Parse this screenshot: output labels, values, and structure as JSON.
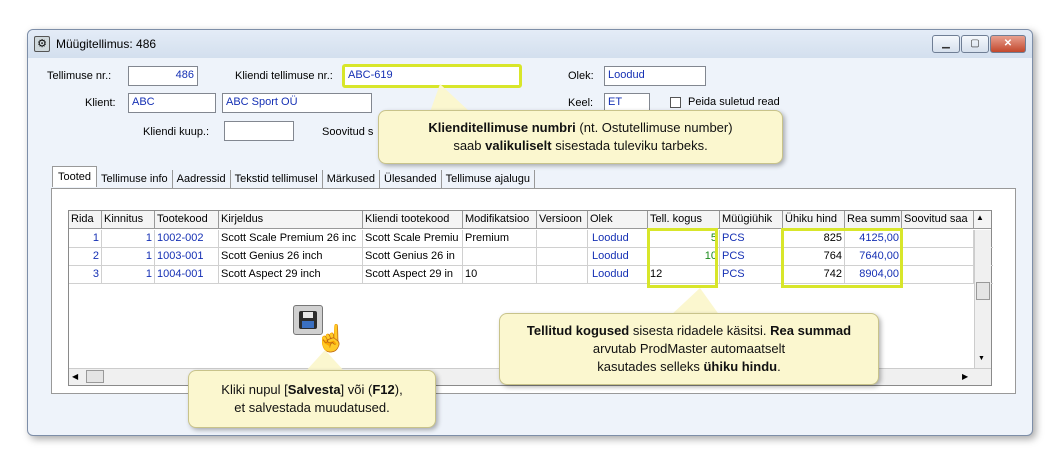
{
  "window": {
    "title": "Müügitellimus: 486"
  },
  "form": {
    "order_nr_label": "Tellimuse nr.:",
    "order_nr_value": "486",
    "client_order_label": "Kliendi tellimuse nr.:",
    "client_order_value": "ABC-619",
    "status_label": "Olek:",
    "status_value": "Loodud",
    "client_label": "Klient:",
    "client_code": "ABC",
    "client_name": "ABC Sport OÜ",
    "lang_label": "Keel:",
    "lang_value": "ET",
    "hide_closed_label": "Peida suletud read",
    "client_buyer_label": "Kliendi kuup.:",
    "recommended_label": "Soovitud s"
  },
  "tabs": [
    "Tooted",
    "Tellimuse info",
    "Aadressid",
    "Tekstid tellimusel",
    "Märkused",
    "Ülesanded",
    "Tellimuse ajalugu"
  ],
  "grid": {
    "headers": [
      "Rida",
      "Kinnitus",
      "Tootekood",
      "Kirjeldus",
      "Kliendi tootekood",
      "Modifikatsioo",
      "Versioon",
      "Olek",
      "Tell. kogus",
      "Müügiühik",
      "Ühiku hind",
      "Rea summ",
      "Soovitud saa"
    ],
    "rows": [
      [
        "1",
        "1",
        "1002-002",
        "Scott Scale Premium 26 inc",
        "Scott Scale Premiu",
        "Premium",
        "",
        "Loodud",
        "5",
        "PCS",
        "825",
        "4125,00",
        ""
      ],
      [
        "2",
        "1",
        "1003-001",
        "Scott Genius 26 inch",
        "Scott Genius 26 in",
        "",
        "",
        "Loodud",
        "10",
        "PCS",
        "764",
        "7640,00",
        ""
      ],
      [
        "3",
        "1",
        "1004-001",
        "Scott Aspect 29 inch",
        "Scott Aspect 29 in",
        "10",
        "",
        "Loodud",
        "12",
        "PCS",
        "742",
        "8904,00",
        ""
      ]
    ]
  },
  "callouts": {
    "c1_bold1": "Klienditellimuse numbri",
    "c1_text1": " (nt. Ostutellimuse number)",
    "c1_text2": "saab ",
    "c1_bold2": "valikuliselt",
    "c1_text3": " sisestada tuleviku tarbeks.",
    "c2_bold1": "Tellitud kogused",
    "c2_text1": " sisesta ridadele käsitsi. ",
    "c2_bold2": "Rea summad",
    "c2_text2": " arvutab ProdMaster automaatselt",
    "c2_text3": "kasutades selleks ",
    "c2_bold3": "ühiku hindu",
    "c2_text4": ".",
    "c3_text1": "Kliki nupul [",
    "c3_bold1": "Salvesta",
    "c3_text2": "] või (",
    "c3_bold2": "F12",
    "c3_text3": "),",
    "c3_text4": "et salvestada muudatused."
  },
  "icons": [
    "app-icon",
    "minimize-icon",
    "maximize-icon",
    "close-icon",
    "save-icon",
    "hand-cursor-icon"
  ],
  "colors": {
    "field_text": "#1530b4",
    "highlight": "#d8e62a",
    "callout_bg": "#fbf7cf",
    "qty_green": "#1a8a1a"
  }
}
